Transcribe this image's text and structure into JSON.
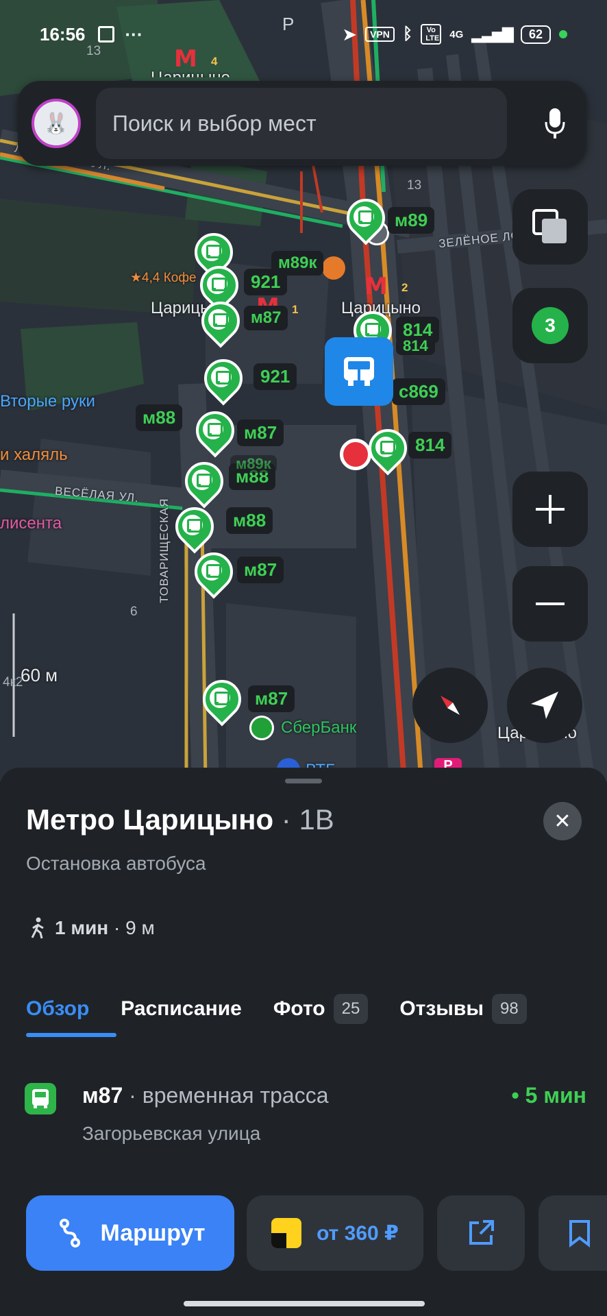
{
  "status_bar": {
    "time": "16:56",
    "dots": "···",
    "vpn": "VPN",
    "volte": "Vo LTE",
    "network": "4G",
    "battery": "62"
  },
  "search": {
    "placeholder": "Поиск и выбор мест"
  },
  "map": {
    "metro_labels": [
      "Царицыно",
      "Царицыно",
      "Царицыно",
      "Царицыно"
    ],
    "metro_numbers": [
      "4",
      "1",
      "2",
      "2"
    ],
    "streets": [
      "ЛУГАНСКАЯ УЛ.",
      "ЗЕЛЁНОЕ ЛО",
      "ВЕСЁЛАЯ УЛ.",
      "ТОВАРИЩЕСКАЯ"
    ],
    "house_numbers": [
      "13",
      "13",
      "6",
      "4к2"
    ],
    "places": {
      "cafe_rating": "★4,4 Кофе",
      "second_hand": "Вторые руки",
      "halal": "и халяль",
      "alisenta": "лисента",
      "sberbank": "СберБанк",
      "vtb": "ВТБ"
    },
    "scale": "60 м",
    "layers_count": "3",
    "route_labels": [
      "м89",
      "921",
      "м89к",
      "м87",
      "814",
      "814",
      "921",
      "с869",
      "м88",
      "м87",
      "м88",
      "814",
      "м89к",
      "м88",
      "м87",
      "м87"
    ]
  },
  "sheet": {
    "title": "Метро Царицыно",
    "platform": " · 1В",
    "subtitle": "Остановка автобуса",
    "walk_time": "1 мин",
    "walk_distance": " · 9 м",
    "tabs": [
      {
        "label": "Обзор"
      },
      {
        "label": "Расписание"
      },
      {
        "label": "Фото",
        "badge": "25"
      },
      {
        "label": "Отзывы",
        "badge": "98"
      }
    ],
    "route": {
      "number": "м87",
      "note": " · временная трасса",
      "eta": "• 5 мин",
      "street": "Загорьевская улица"
    },
    "actions": {
      "route_label": "Маршрут",
      "taxi_label": "от 360 ₽"
    }
  },
  "colors": {
    "accent": "#3a82f6",
    "transit_green": "#25b24a",
    "metro_red": "#e6303c"
  }
}
